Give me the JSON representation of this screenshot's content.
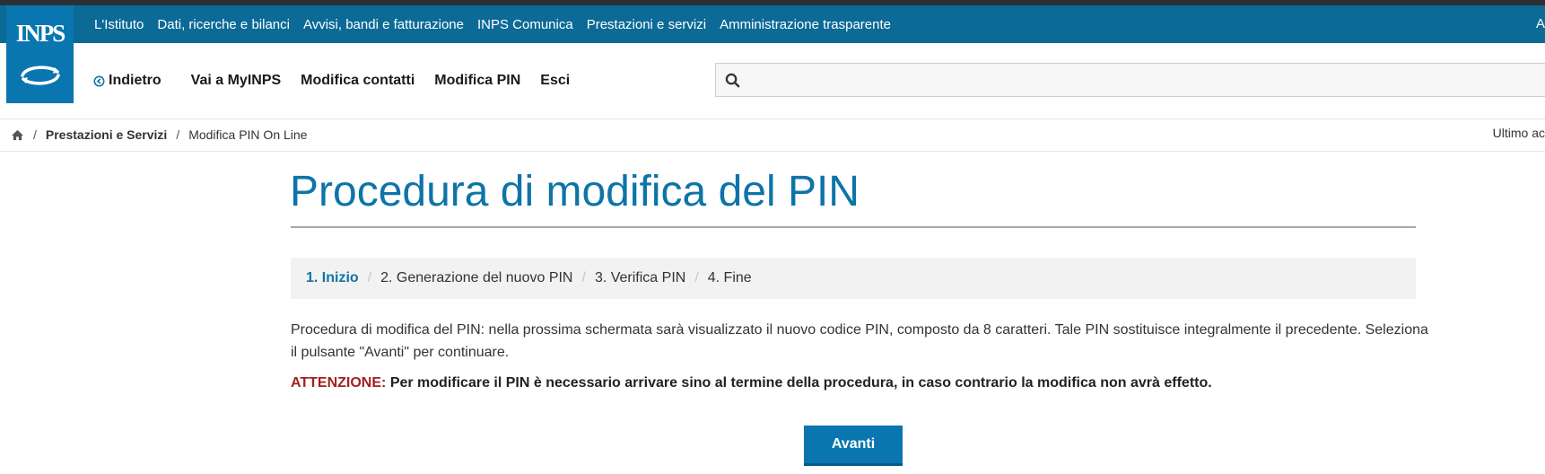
{
  "header": {
    "logo_text": "INPS",
    "top_links": [
      "L'Istituto",
      "Dati, ricerche e bilanci",
      "Avvisi, bandi e fatturazione",
      "INPS Comunica",
      "Prestazioni e servizi",
      "Amministrazione trasparente"
    ],
    "top_right_partial": "A",
    "secondary_nav": {
      "back": "Indietro",
      "myinps": "Vai a MyINPS",
      "contacts": "Modifica contatti",
      "pin": "Modifica PIN",
      "exit": "Esci"
    },
    "search": {
      "placeholder": "",
      "value": ""
    }
  },
  "breadcrumb": {
    "section": "Prestazioni e Servizi",
    "current": "Modifica PIN On Line",
    "last_update_partial": "Ultimo ac"
  },
  "main": {
    "title": "Procedura di modifica del PIN",
    "steps": [
      "1. Inizio",
      "2. Generazione del nuovo PIN",
      "3. Verifica PIN",
      "4. Fine"
    ],
    "active_step": 0,
    "description": "Procedura di modifica del PIN: nella prossima schermata sarà visualizzato il nuovo codice PIN, composto da 8 caratteri. Tale PIN sostituisce integralmente il precedente. Seleziona il pulsante \"Avanti\" per continuare.",
    "warning_label": "ATTENZIONE:",
    "warning_text": "Per modificare il PIN è necessario arrivare sino al termine della procedura, in caso contrario la modifica non avrà effetto.",
    "next_button": "Avanti"
  },
  "colors": {
    "brand_blue": "#0c6a97",
    "title_blue": "#0e74a8",
    "warning_red": "#a42020"
  }
}
